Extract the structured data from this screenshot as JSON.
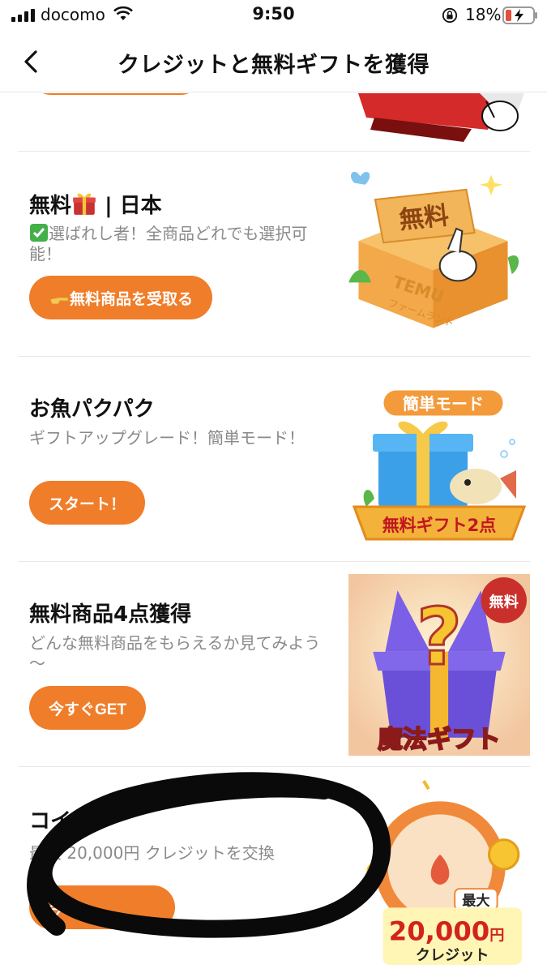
{
  "status_bar": {
    "carrier": "docomo",
    "time": "9:50",
    "battery": "18%",
    "battery_color": "#e64d3d"
  },
  "nav": {
    "back_icon": "chevron-left-icon",
    "title": "クレジットと無料ギフトを獲得"
  },
  "cards": [
    {
      "title_prefix": "無料",
      "title_suffix": " | 日本",
      "title_icon": "gift-emoji-icon",
      "desc_icon": "check-box-icon",
      "desc": "選ばれし者！全商品どれでも選択可能！",
      "cta_icon": "pointing-hand-icon",
      "cta": "無料商品を受取る",
      "art_label": "無料",
      "art_brand": "TEMU",
      "art_sub": "ファームランド"
    },
    {
      "title": "お魚パクパク",
      "desc": "ギフトアップグレード！簡単モード！",
      "cta": "スタート！",
      "art_badge": "簡単モード",
      "art_banner": "無料ギフト2点"
    },
    {
      "title": "無料商品4点獲得",
      "desc": "どんな無料商品をもらえるか見てみよう～",
      "cta": "今すぐGET",
      "art_badge": "無料",
      "art_banner": "魔法ギフト"
    },
    {
      "title": "コイン",
      "desc": "最大 20,000円 クレジットを交換",
      "cta": "今す",
      "art_top": "最大",
      "art_amount": "20,000",
      "art_unit": "円",
      "art_sub": "クレジット"
    }
  ],
  "colors": {
    "accent": "#ef7d29",
    "desc_gray": "#8a8a8a",
    "divider": "#e8e8e8"
  }
}
